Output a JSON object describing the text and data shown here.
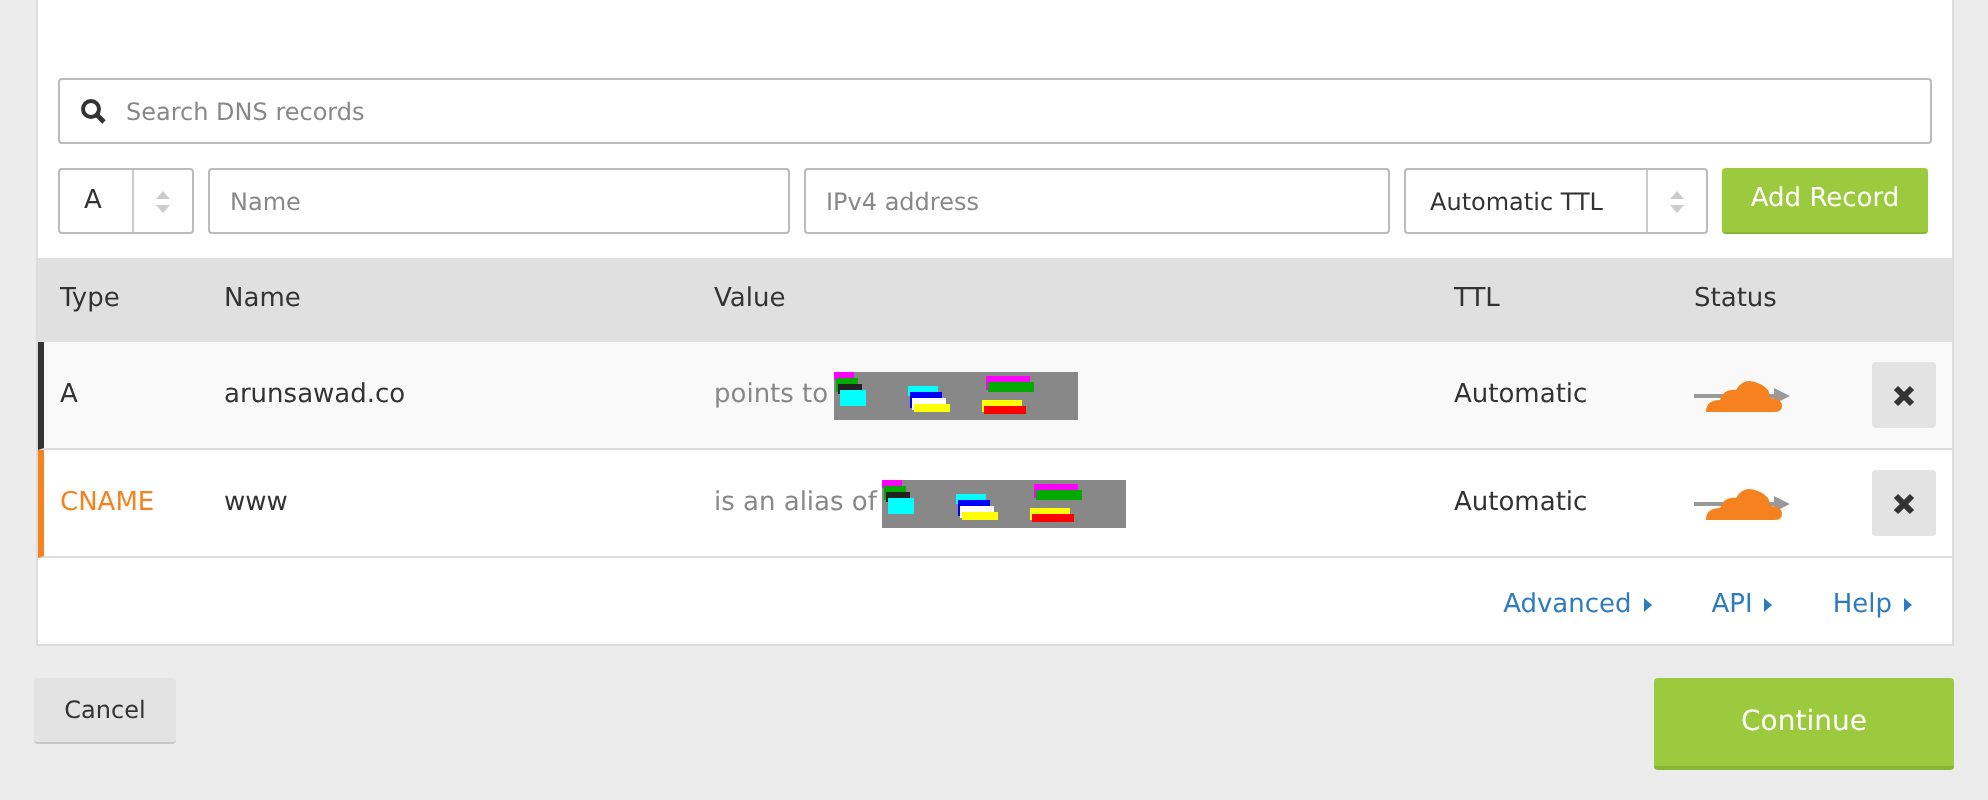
{
  "search": {
    "placeholder": "Search DNS records"
  },
  "new_record": {
    "type": "A",
    "name_placeholder": "Name",
    "value_placeholder": "IPv4 address",
    "ttl": "Automatic TTL",
    "add_button": "Add Record"
  },
  "table": {
    "columns": [
      "Type",
      "Name",
      "Value",
      "TTL",
      "Status"
    ],
    "rows": [
      {
        "type": "A",
        "name": "arunsawad.co",
        "value_prefix": "points to",
        "ttl": "Automatic",
        "proxied": true,
        "color": "#333333"
      },
      {
        "type": "CNAME",
        "name": "www",
        "value_prefix": "is an alias of",
        "ttl": "Automatic",
        "proxied": true,
        "color": "#f6821f"
      }
    ]
  },
  "links": [
    "Advanced",
    "API",
    "Help"
  ],
  "cancel_button": "Cancel",
  "continue_button": "Continue"
}
